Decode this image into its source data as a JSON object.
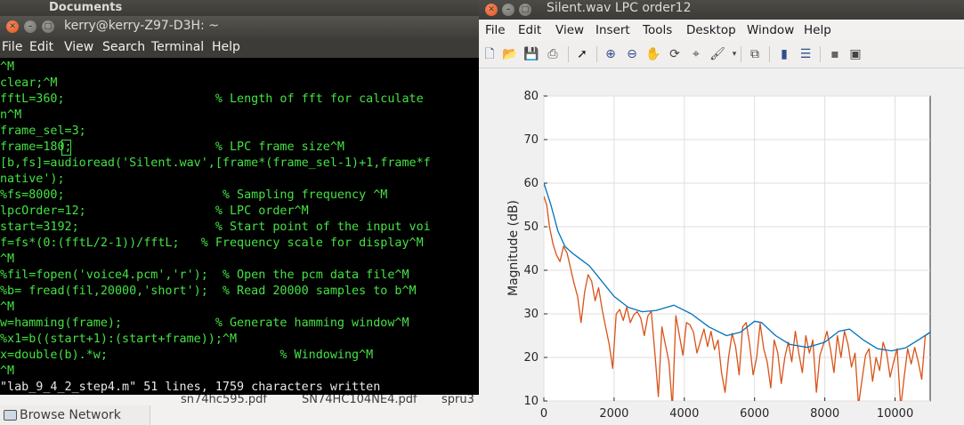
{
  "background": {
    "title": "Documents",
    "sidebar_item": "Browse Network",
    "files": [
      "sn74hc595.pdf",
      "SN74HC104NE4.pdf",
      "spru3"
    ]
  },
  "terminal": {
    "title": "kerry@kerry-Z97-D3H: ~",
    "menu": [
      "File",
      "Edit",
      "View",
      "Search",
      "Terminal",
      "Help"
    ],
    "lines": [
      "^M",
      "clear;^M",
      "fftL=360;                     % Length of fft for calculate",
      "n^M",
      "frame_sel=3;",
      "frame=180;                    % LPC frame size^M",
      "[b,fs]=audioread('Silent.wav',[frame*(frame_sel-1)+1,frame*f",
      "native');",
      "%fs=8000;                      % Sampling frequency ^M",
      "lpcOrder=12;                  % LPC order^M",
      "start=3192;                   % Start point of the input voi",
      "f=fs*(0:(fftL/2-1))/fftL;   % Frequency scale for display^M",
      "^M",
      "%fil=fopen('voice4.pcm','r');  % Open the pcm data file^M",
      "%b= fread(fil,20000,'short');  % Read 20000 samples to b^M",
      "^M",
      "w=hamming(frame);             % Generate hamming window^M",
      "%x1=b((start+1):(start+frame));^M",
      "x=double(b).*w;                        % Windowing^M",
      "^M"
    ],
    "status": "\"lab_9_4_2_step4.m\" 51 lines, 1759 characters written"
  },
  "figure": {
    "title": "Silent.wav LPC order12",
    "menu": [
      "File",
      "Edit",
      "View",
      "Insert",
      "Tools",
      "Desktop",
      "Window",
      "Help"
    ],
    "toolbar_icons": [
      "new-figure-icon",
      "open-icon",
      "save-icon",
      "print-icon",
      "pointer-icon",
      "zoom-in-icon",
      "zoom-out-icon",
      "pan-icon",
      "rotate-icon",
      "data-cursor-icon",
      "brush-icon",
      "link-icon",
      "colorbar-icon",
      "legend-icon",
      "hide-plot-tools-icon",
      "show-plot-tools-icon"
    ]
  },
  "chart_data": {
    "type": "line",
    "title": "",
    "xlabel": "",
    "ylabel": "Magnitude (dB)",
    "xlim": [
      0,
      11000
    ],
    "ylim": [
      10,
      80
    ],
    "xticks": [
      0,
      2000,
      4000,
      6000,
      8000,
      10000
    ],
    "yticks": [
      10,
      20,
      30,
      40,
      50,
      60,
      70,
      80
    ],
    "grid": true,
    "colors": {
      "lpc_envelope": "#0072bd",
      "fft_spectrum": "#d95319"
    },
    "series": [
      {
        "color": "#0072bd",
        "x": [
          0,
          200,
          400,
          600,
          800,
          1000,
          1300,
          1600,
          2000,
          2400,
          2800,
          3200,
          3700,
          4200,
          4700,
          5200,
          5600,
          6000,
          6200,
          6600,
          7000,
          7500,
          8000,
          8400,
          8700,
          9100,
          9500,
          9900,
          10300,
          10700,
          11000
        ],
        "y": [
          60,
          55,
          49,
          45.5,
          44,
          42.8,
          41,
          38,
          34,
          31.5,
          30.5,
          30.8,
          32,
          30,
          27,
          25,
          25.8,
          28.3,
          28,
          25,
          23,
          22.3,
          23.5,
          26,
          26.5,
          24,
          22,
          21.5,
          22.2,
          24.2,
          25.8
        ]
      },
      {
        "color": "#d95319",
        "x": [
          0,
          80,
          160,
          260,
          360,
          460,
          560,
          660,
          760,
          860,
          960,
          1060,
          1160,
          1260,
          1360,
          1460,
          1560,
          1660,
          1760,
          1860,
          1960,
          2060,
          2160,
          2260,
          2360,
          2460,
          2560,
          2660,
          2760,
          2860,
          2960,
          3060,
          3160,
          3260,
          3360,
          3460,
          3560,
          3660,
          3760,
          3860,
          3960,
          4060,
          4160,
          4260,
          4360,
          4460,
          4560,
          4660,
          4760,
          4860,
          4960,
          5060,
          5160,
          5260,
          5360,
          5460,
          5560,
          5660,
          5760,
          5860,
          5960,
          6060,
          6160,
          6260,
          6360,
          6460,
          6560,
          6660,
          6760,
          6860,
          6960,
          7060,
          7160,
          7260,
          7360,
          7460,
          7560,
          7660,
          7760,
          7860,
          7960,
          8060,
          8160,
          8260,
          8360,
          8460,
          8560,
          8660,
          8760,
          8860,
          8960,
          9060,
          9160,
          9260,
          9360,
          9460,
          9560,
          9660,
          9760,
          9860,
          9960,
          10060,
          10160,
          10260,
          10360,
          10460,
          10560,
          10660,
          10760,
          10860,
          10960
        ],
        "y": [
          57,
          55,
          50,
          46,
          43.5,
          42,
          45.5,
          44,
          40.5,
          37,
          34,
          28,
          35,
          39,
          37.5,
          33,
          36,
          31,
          27,
          23,
          17.5,
          30,
          31,
          28.5,
          31.5,
          28,
          29.8,
          30.5,
          29,
          25,
          29.5,
          30.6,
          21,
          11,
          27,
          23,
          19,
          8.5,
          29.6,
          25,
          20.5,
          28,
          27.5,
          25.8,
          21,
          23.8,
          26.5,
          22.5,
          26,
          21.8,
          24,
          16.5,
          12,
          20,
          25.5,
          22.5,
          16,
          27,
          28,
          23,
          16,
          20,
          27.8,
          22,
          19,
          13,
          24,
          21,
          14,
          20,
          23.5,
          19,
          26,
          21,
          16.5,
          25,
          21,
          24,
          12,
          20.5,
          23,
          26,
          22,
          16.5,
          25,
          20,
          26,
          23,
          17.8,
          21,
          9,
          15,
          20.5,
          22,
          14.5,
          20,
          17,
          23.5,
          21,
          15.5,
          19,
          22,
          8.5,
          15.5,
          22,
          18.5,
          22.3,
          19,
          15,
          25,
          25.5
        ]
      }
    ]
  }
}
